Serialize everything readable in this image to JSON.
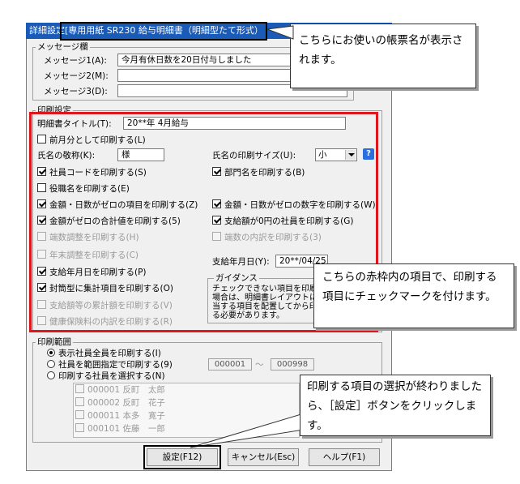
{
  "window": {
    "title": "詳細設定[専用用紙 SR230 給与明細書（明細型たて形式）"
  },
  "callouts": {
    "top": "こちらにお使いの帳票名が表示されます。",
    "mid": "こちらの赤枠内の項目で、印刷する項目にチェックマークを付けます。",
    "bottom": "印刷する項目の選択が終わりましたら、［設定］ボタンをクリックします。"
  },
  "message": {
    "group_label": "メッセージ欄",
    "m1_label": "メッセージ1(A):",
    "m1_value": "今月有休日数を20日付与しました",
    "m2_label": "メッセージ2(M):",
    "m2_value": "",
    "m3_label": "メッセージ3(D):",
    "m3_value": ""
  },
  "print": {
    "group_label": "印刷設定",
    "title_label": "明細書タイトル(T):",
    "title_value": "20**年 4月給与",
    "prev_month": "前月分として印刷する(L)",
    "honorific_label": "氏名の敬称(K):",
    "honorific_value": "様",
    "name_size_label": "氏名の印刷サイズ(U):",
    "name_size_value": "小",
    "help": "?",
    "emp_code": "社員コードを印刷する(S)",
    "dept": "部門名を印刷する(B)",
    "role": "役職名を印刷する(E)",
    "zero_item": "金額・日数がゼロの項目を印刷する(Z)",
    "zero_number": "金額・日数がゼロの数字を印刷する(W)",
    "zero_total": "金額がゼロの合計値を印刷する(5)",
    "zero_pay": "支給額が0円の社員を印刷する(G)",
    "rounding": "端数調整を印刷する(H)",
    "rounding_detail": "端数の内訳を印刷する(3)",
    "yearend": "年末調整を印刷する(C)",
    "pay_date_print": "支給年月日を印刷する(P)",
    "pay_date_label": "支給年月日(Y):",
    "pay_date_value": "20**/04/25",
    "envelope": "封筒型に集計項目を印刷する(O)",
    "cumulative": "支給額等の累計額を印刷する(V)",
    "insurance": "健康保険料の内訳を印刷する(R)",
    "guidance_label": "ガイダンス",
    "guidance_text": "チェックできない項目を印刷する場合は、明細書レイアウトにて該当する項目を配置してから印刷する必要があります。"
  },
  "range": {
    "group_label": "印刷範囲",
    "opt_all": "表示社員全員を印刷する(I)",
    "opt_code": "社員を範囲指定で印刷する(9)",
    "opt_select": "印刷する社員を選択する(N)",
    "from": "000001",
    "tilde": "～",
    "to": "000998",
    "employees": [
      {
        "code": "000001",
        "name": "反町　太郎"
      },
      {
        "code": "000002",
        "name": "反町　花子"
      },
      {
        "code": "000011",
        "name": "本多　寛子"
      },
      {
        "code": "000101",
        "name": "佐藤　一郎"
      }
    ]
  },
  "buttons": {
    "ok": "設定(F12)",
    "cancel": "キャンセル(Esc)",
    "help": "ヘルプ(F1)"
  }
}
